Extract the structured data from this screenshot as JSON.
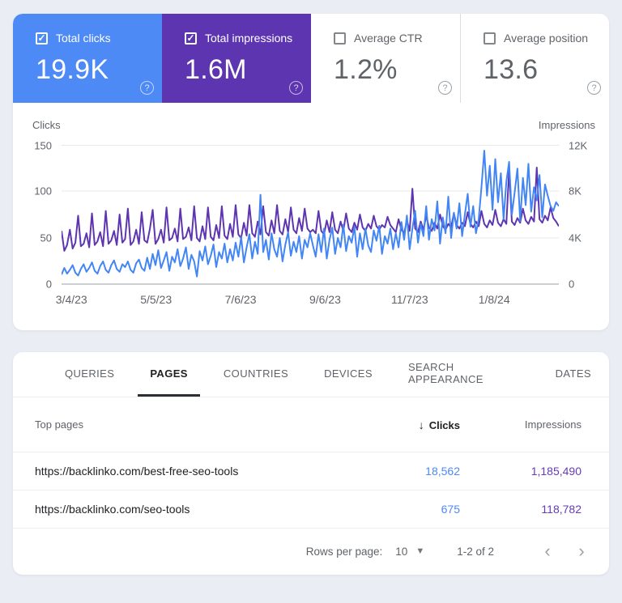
{
  "colors": {
    "clicks_accent": "#4d8af5",
    "impressions_accent": "#5e35b1",
    "page_background": "#eaedf4",
    "table_clicks_text": "#4d8af5",
    "table_impressions_text": "#673ab7"
  },
  "icons": {
    "checkbox_check": "✓",
    "help": "?",
    "sort_desc": "↓",
    "dropdown": "▼",
    "prev_chevron": "‹",
    "next_chevron": "›"
  },
  "summary_cards": [
    {
      "label": "Total clicks",
      "value": "19.9K",
      "checked": true
    },
    {
      "label": "Total impressions",
      "value": "1.6M",
      "checked": true
    },
    {
      "label": "Average CTR",
      "value": "1.2%",
      "checked": false
    },
    {
      "label": "Average position",
      "value": "13.6",
      "checked": false
    }
  ],
  "chart_data": {
    "type": "line",
    "left_axis_label": "Clicks",
    "right_axis_label": "Impressions",
    "left_ylim": [
      0,
      150
    ],
    "right_ylim": [
      0,
      12000
    ],
    "left_ticks": [
      "150",
      "100",
      "50",
      "0"
    ],
    "right_ticks": [
      "12K",
      "8K",
      "4K",
      "0"
    ],
    "x_tick_labels": [
      "3/4/23",
      "5/5/23",
      "7/6/23",
      "9/6/23",
      "11/7/23",
      "1/8/24"
    ],
    "grid": true,
    "series": [
      {
        "name": "Total clicks",
        "axis": "left",
        "color": "#4285f4",
        "values": [
          11,
          18,
          12,
          16,
          21,
          13,
          10,
          17,
          22,
          14,
          18,
          24,
          15,
          12,
          20,
          25,
          16,
          13,
          21,
          26,
          17,
          14,
          22,
          19,
          25,
          16,
          13,
          23,
          27,
          18,
          15,
          29,
          17,
          33,
          21,
          37,
          18,
          26,
          35,
          15,
          30,
          24,
          38,
          20,
          28,
          40,
          17,
          32,
          25,
          9,
          36,
          26,
          41,
          22,
          31,
          43,
          19,
          35,
          28,
          44,
          24,
          38,
          26,
          45,
          30,
          51,
          24,
          40,
          54,
          28,
          46,
          33,
          96,
          35,
          48,
          27,
          55,
          38,
          30,
          50,
          25,
          43,
          56,
          31,
          46,
          35,
          52,
          28,
          48,
          40,
          55,
          42,
          30,
          54,
          35,
          60,
          28,
          48,
          61,
          33,
          50,
          40,
          64,
          36,
          52,
          45,
          62,
          30,
          55,
          38,
          60,
          42,
          35,
          58,
          47,
          63,
          33,
          52,
          44,
          60,
          38,
          55,
          40,
          67,
          48,
          74,
          38,
          60,
          79,
          45,
          65,
          52,
          84,
          48,
          70,
          58,
          89,
          44,
          72,
          55,
          94,
          50,
          77,
          60,
          87,
          52,
          75,
          97,
          62,
          84,
          55,
          70,
          104,
          143,
          95,
          127,
          80,
          134,
          88,
          119,
          70,
          110,
          131,
          75,
          98,
          124,
          68,
          114,
          85,
          129,
          78,
          104,
          90,
          117,
          72,
          107,
          95,
          84,
          79,
          88,
          84
        ]
      },
      {
        "name": "Total impressions",
        "axis": "right",
        "color": "#5e35b1",
        "values": [
          4600,
          2900,
          3400,
          4700,
          3100,
          3600,
          5900,
          3300,
          3500,
          4400,
          3200,
          6100,
          3400,
          3700,
          4500,
          3300,
          6300,
          3500,
          3800,
          4600,
          3400,
          6000,
          3600,
          3900,
          6500,
          3400,
          3700,
          4700,
          3500,
          6200,
          3800,
          3600,
          4800,
          6400,
          3500,
          3900,
          4700,
          3600,
          6600,
          3800,
          4000,
          4800,
          3700,
          6500,
          3900,
          4100,
          4900,
          3800,
          6700,
          4000,
          3700,
          5000,
          3900,
          6600,
          4100,
          3800,
          5100,
          4000,
          6700,
          4200,
          3900,
          5200,
          4100,
          6800,
          4300,
          4000,
          5300,
          4200,
          6800,
          4400,
          4100,
          5400,
          4300,
          6700,
          4500,
          4200,
          5500,
          4400,
          6800,
          4600,
          4300,
          5600,
          4500,
          6600,
          4700,
          4400,
          5700,
          4600,
          6500,
          4800,
          4500,
          4700,
          4400,
          6300,
          4600,
          4300,
          5500,
          4500,
          6200,
          4700,
          4400,
          5400,
          4600,
          6100,
          4800,
          4500,
          5300,
          4700,
          6000,
          4900,
          4600,
          5200,
          4800,
          5900,
          5000,
          4700,
          5100,
          4900,
          5800,
          5100,
          4800,
          4500,
          5600,
          4700,
          4400,
          5500,
          4600,
          8200,
          4800,
          4500,
          5400,
          4700,
          5900,
          4900,
          4600,
          5300,
          4800,
          6000,
          5000,
          4700,
          5200,
          4900,
          6100,
          5100,
          4800,
          5300,
          5000,
          6200,
          5200,
          4900,
          5400,
          5000,
          6300,
          5200,
          4900,
          5500,
          5100,
          6400,
          5300,
          5000,
          5600,
          5200,
          9800,
          5400,
          5100,
          5700,
          5300,
          6500,
          5500,
          5200,
          5800,
          5400,
          10000,
          5600,
          5300,
          5900,
          5500,
          6600,
          5700,
          5400,
          5000
        ]
      }
    ]
  },
  "tabs": [
    {
      "label": "QUERIES",
      "active": false
    },
    {
      "label": "PAGES",
      "active": true
    },
    {
      "label": "COUNTRIES",
      "active": false
    },
    {
      "label": "DEVICES",
      "active": false
    },
    {
      "label": "SEARCH APPEARANCE",
      "active": false
    },
    {
      "label": "DATES",
      "active": false
    }
  ],
  "table": {
    "columns": {
      "pages": "Top pages",
      "clicks": "Clicks",
      "impressions": "Impressions"
    },
    "sorted_by": "Clicks",
    "rows": [
      {
        "url": "https://backlinko.com/best-free-seo-tools",
        "clicks": "18,562",
        "impressions": "1,185,490"
      },
      {
        "url": "https://backlinko.com/seo-tools",
        "clicks": "675",
        "impressions": "118,782"
      }
    ]
  },
  "pagination": {
    "rows_per_page_label": "Rows per page:",
    "rows_per_page_value": "10",
    "range": "1-2 of 2"
  }
}
